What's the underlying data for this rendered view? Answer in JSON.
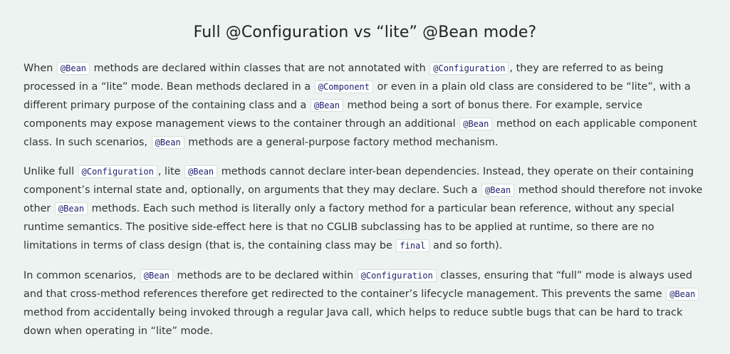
{
  "article": {
    "title": "Full @Configuration vs “lite” @Bean mode?",
    "paragraphs": [
      [
        {
          "t": "text",
          "v": "When "
        },
        {
          "t": "code",
          "v": "@Bean"
        },
        {
          "t": "text",
          "v": " methods are declared within classes that are not annotated with "
        },
        {
          "t": "code",
          "v": "@Configuration"
        },
        {
          "t": "text",
          "v": ", they are referred to as being processed in a “lite” mode. Bean methods declared in a "
        },
        {
          "t": "code",
          "v": "@Component"
        },
        {
          "t": "text",
          "v": " or even in a plain old class are considered to be “lite”, with a different primary purpose of the containing class and a "
        },
        {
          "t": "code",
          "v": "@Bean"
        },
        {
          "t": "text",
          "v": " method being a sort of bonus there. For example, service components may expose management views to the container through an additional "
        },
        {
          "t": "code",
          "v": "@Bean"
        },
        {
          "t": "text",
          "v": " method on each applicable component class. In such scenarios, "
        },
        {
          "t": "code",
          "v": "@Bean"
        },
        {
          "t": "text",
          "v": " methods are a general-purpose factory method mechanism."
        }
      ],
      [
        {
          "t": "text",
          "v": "Unlike full "
        },
        {
          "t": "code",
          "v": "@Configuration"
        },
        {
          "t": "text",
          "v": ", lite "
        },
        {
          "t": "code",
          "v": "@Bean"
        },
        {
          "t": "text",
          "v": " methods cannot declare inter-bean dependencies. Instead, they operate on their containing component’s internal state and, optionally, on arguments that they may declare. Such a "
        },
        {
          "t": "code",
          "v": "@Bean"
        },
        {
          "t": "text",
          "v": " method should therefore not invoke other "
        },
        {
          "t": "code",
          "v": "@Bean"
        },
        {
          "t": "text",
          "v": " methods. Each such method is literally only a factory method for a particular bean reference, without any special runtime semantics. The positive side-effect here is that no CGLIB subclassing has to be applied at runtime, so there are no limitations in terms of class design (that is, the containing class may be "
        },
        {
          "t": "code",
          "v": "final"
        },
        {
          "t": "text",
          "v": " and so forth)."
        }
      ],
      [
        {
          "t": "text",
          "v": "In common scenarios, "
        },
        {
          "t": "code",
          "v": "@Bean"
        },
        {
          "t": "text",
          "v": " methods are to be declared within "
        },
        {
          "t": "code",
          "v": "@Configuration"
        },
        {
          "t": "text",
          "v": " classes, ensuring that “full” mode is always used and that cross-method references therefore get redirected to the container’s lifecycle management. This prevents the same "
        },
        {
          "t": "code",
          "v": "@Bean"
        },
        {
          "t": "text",
          "v": " method from accidentally being invoked through a regular Java call, which helps to reduce subtle bugs that can be hard to track down when operating in “lite” mode."
        }
      ]
    ]
  }
}
